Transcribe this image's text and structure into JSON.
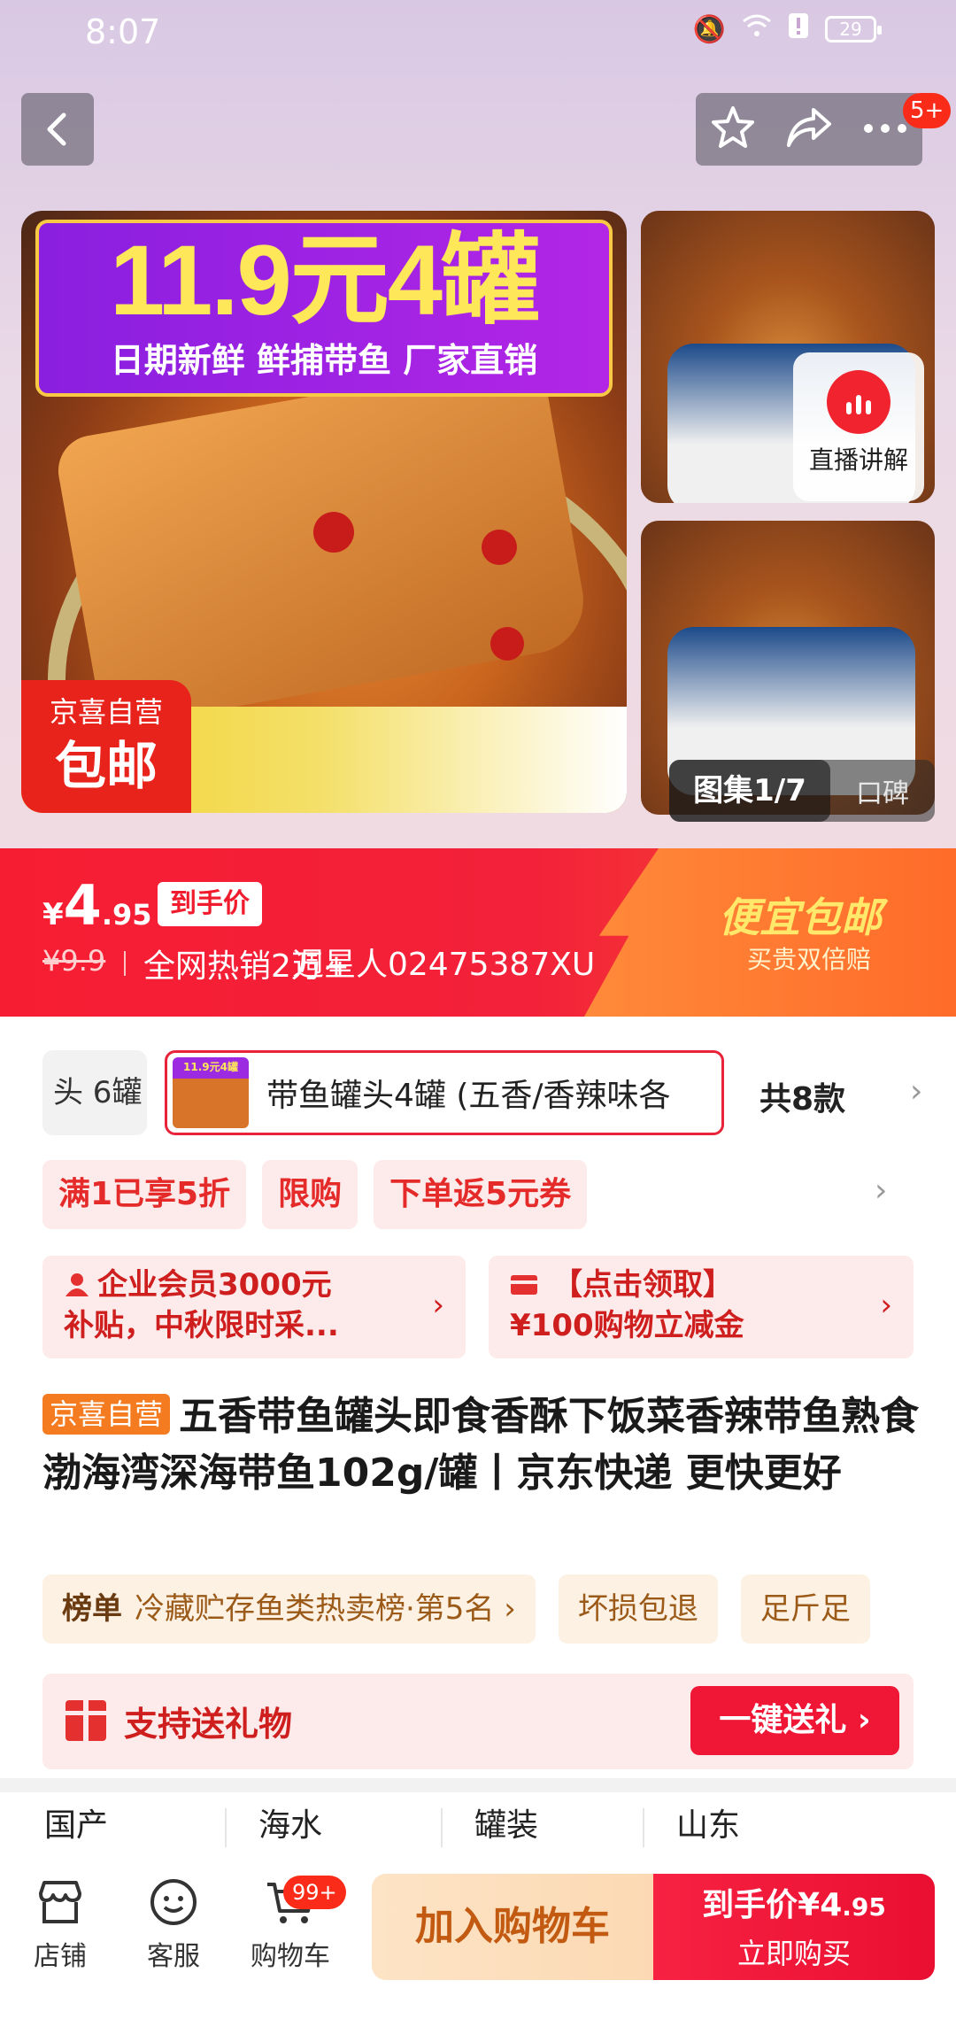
{
  "status": {
    "time": "8:07",
    "battery": "29"
  },
  "header": {
    "badge": "5+"
  },
  "gallery": {
    "promo_title": "11.9元4罐",
    "promo_sub": "日期新鲜  鲜捕带鱼  厂家直销",
    "self_tag_line1": "京喜自营",
    "self_tag_line2": "包邮",
    "live_label": "直播讲解",
    "tab_active": "图集1/7",
    "tab_other": "口碑"
  },
  "price": {
    "yen": "¥",
    "integer": "4",
    "decimal": ".95",
    "tag": "到手价",
    "original": "¥9.9",
    "hot_text": "全网热销2万+",
    "overlay_text": "週星人02475387XU",
    "promo_title": "便宜包邮",
    "promo_sub": "买贵双倍赔"
  },
  "variants": {
    "prev_label": "头 6罐",
    "thumb_text": "11.9元4罐",
    "current_label": "带鱼罐头4罐 (五香/香辣味各",
    "count": "共8款",
    "chevron": "›"
  },
  "promos": {
    "items": [
      "满1已享5折",
      "限购",
      "下单返5元券"
    ],
    "chevron": "›"
  },
  "coupons": {
    "c1_line1": "企业会员3000元",
    "c1_line2": "补贴，中秋限时采...",
    "c2_line1": "【点击领取】",
    "c2_line2": "¥100购物立减金",
    "chevron": "›"
  },
  "product": {
    "badge": "京喜自营",
    "title": "五香带鱼罐头即食香酥下饭菜香辣带鱼熟食渤海湾深海带鱼102g/罐丨京东快递 更快更好"
  },
  "tags": {
    "rank_label": "榜单",
    "rank_text": "冷藏贮存鱼类热卖榜·第5名 ›",
    "t2": "坏损包退",
    "t3": "足斤足"
  },
  "gift": {
    "label": "支持送礼物",
    "button": "一键送礼 ›"
  },
  "specs": [
    "国产",
    "海水",
    "罐装",
    "山东"
  ],
  "bottom": {
    "store": "店铺",
    "service": "客服",
    "cart": "购物车",
    "cart_badge": "99+",
    "add_cart": "加入购物车",
    "buy_line1": "到手价¥4",
    "buy_line1_dec": ".95",
    "buy_line2": "立即购买"
  }
}
